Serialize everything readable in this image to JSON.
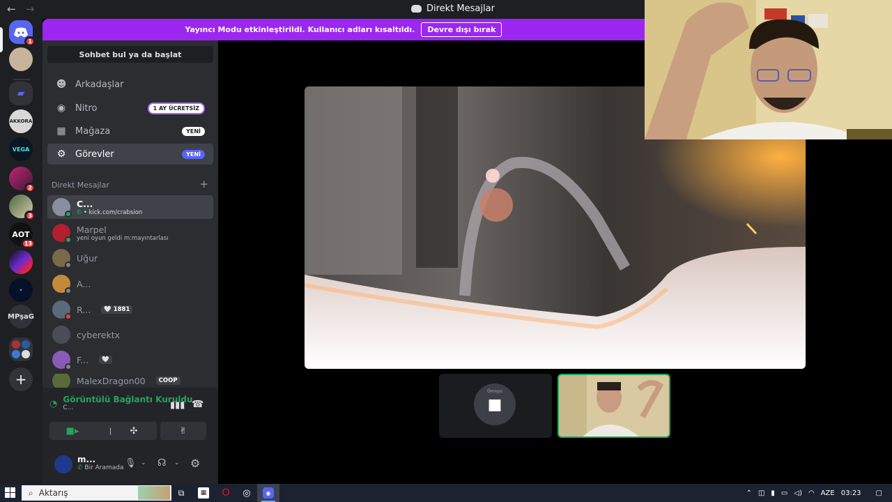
{
  "titlebar": {
    "back": "←",
    "forward": "→",
    "title": "Direkt Mesajlar"
  },
  "banner": {
    "text": "Yayıncı Modu etkinleştirildi. Kullanıcı adları kısaltıldı.",
    "button": "Devre dışı bırak"
  },
  "rail": {
    "servers": [
      {
        "label": "",
        "badge": "1"
      },
      {
        "label": "",
        "badge": ""
      },
      {
        "label": "",
        "badge": ""
      },
      {
        "label": "AKKORA",
        "badge": ""
      },
      {
        "label": "VEGA",
        "badge": ""
      },
      {
        "label": "",
        "badge": "2"
      },
      {
        "label": "",
        "badge": "3"
      },
      {
        "label": "AOT",
        "badge": "13"
      },
      {
        "label": "",
        "badge": ""
      },
      {
        "label": "",
        "badge": ""
      },
      {
        "label": "MPşaG",
        "badge": ""
      },
      {
        "label": "",
        "badge": ""
      }
    ],
    "add": "+"
  },
  "sidebar": {
    "find": "Sohbet bul ya da başlat",
    "nav": [
      {
        "label": "Arkadaşlar",
        "tag": ""
      },
      {
        "label": "Nitro",
        "tag": "1 AY ÜCRETSİZ"
      },
      {
        "label": "Mağaza",
        "tag": "YENİ"
      },
      {
        "label": "Görevler",
        "tag": "YENİ"
      }
    ],
    "dm_header": "Direkt Mesajlar",
    "dm_add": "+",
    "dms": [
      {
        "name": "C...",
        "sub": "• kick.com/crabsion",
        "chip": ""
      },
      {
        "name": "Marpel",
        "sub": "yeni oyun geldi m:mayıntarlası",
        "chip": ""
      },
      {
        "name": "Uğur",
        "sub": "",
        "chip": ""
      },
      {
        "name": "A...",
        "sub": "",
        "chip": ""
      },
      {
        "name": "R...",
        "sub": "",
        "chip": "🤍 1881"
      },
      {
        "name": "cyberektx",
        "sub": "",
        "chip": ""
      },
      {
        "name": "F...",
        "sub": "",
        "chip": "🤍"
      },
      {
        "name": "MalexDragon00",
        "sub": "",
        "chip": "COOP"
      }
    ]
  },
  "voice": {
    "status": "Görüntülü Bağlantı Kuruldu",
    "channel": "C..."
  },
  "user": {
    "name": "m...",
    "status": "Bir Aramada"
  },
  "thumbs": {
    "first_label": "Ӧmnpo"
  },
  "taskbar": {
    "search_placeholder": "Aktarış",
    "lang": "AZE",
    "time": "03:23"
  },
  "colors": {
    "blurple": "#5865f2",
    "streamer_purple": "#9b27f0",
    "online": "#23a55a",
    "danger": "#f23f43"
  }
}
